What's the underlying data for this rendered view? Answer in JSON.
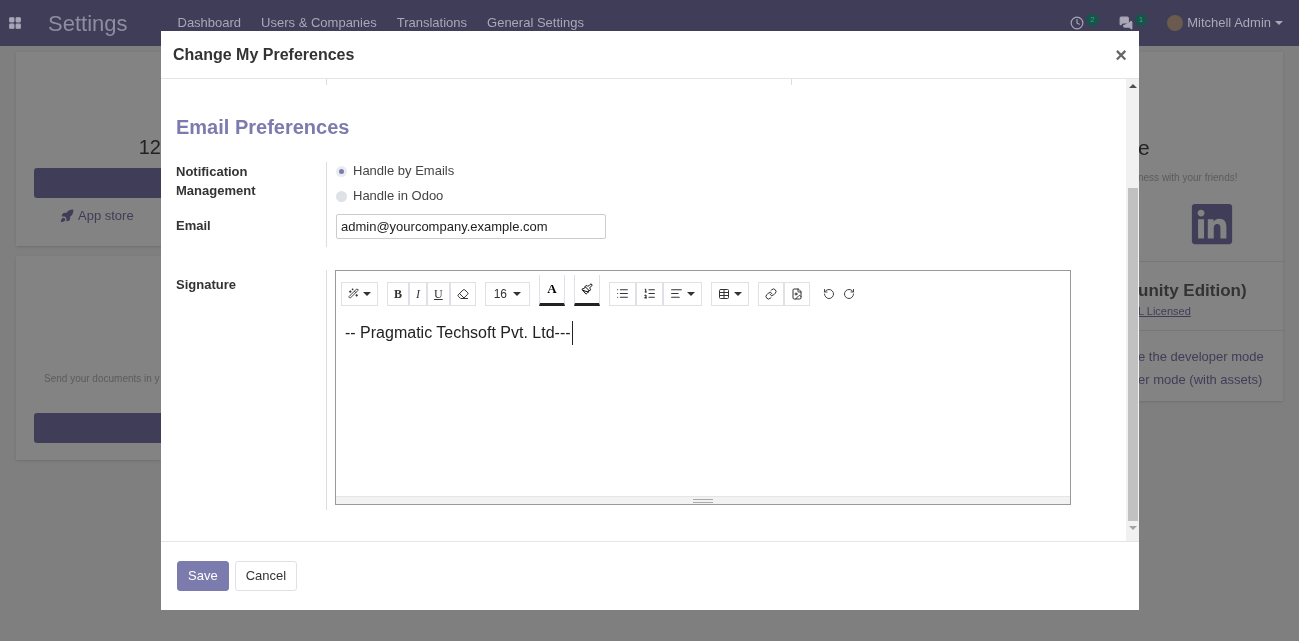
{
  "navbar": {
    "app_title": "Settings",
    "menu": [
      "Dashboard",
      "Users & Companies",
      "Translations",
      "General Settings"
    ],
    "activity_count": "2",
    "message_count": "1",
    "user": "Mitchell Admin"
  },
  "background": {
    "left_number": "12",
    "app_store": "App store",
    "send_docs": "Send your documents in y",
    "heading_fragment": "e",
    "invite_text": "ness with your friends!",
    "edition": "unity Edition)",
    "license": "L Licensed",
    "developer_links": [
      "e the developer mode",
      "er mode (with assets)"
    ]
  },
  "dialog": {
    "title": "Change My Preferences",
    "close": "×",
    "section_title": "Email Preferences",
    "notification": {
      "label": "Notification Management",
      "options": [
        {
          "label": "Handle by Emails",
          "selected": true
        },
        {
          "label": "Handle in Odoo",
          "selected": false
        }
      ]
    },
    "email": {
      "label": "Email",
      "value": "admin@yourcompany.example.com"
    },
    "signature": {
      "label": "Signature",
      "toolbar": {
        "bold": "B",
        "italic": "I",
        "underline": "U",
        "font_size": "16",
        "font_color": "A"
      },
      "content": "-- Pragmatic Techsoft Pvt. Ltd---"
    },
    "buttons": [
      {
        "label": "Save",
        "kind": "primary"
      },
      {
        "label": "Cancel",
        "kind": "secondary"
      }
    ]
  }
}
